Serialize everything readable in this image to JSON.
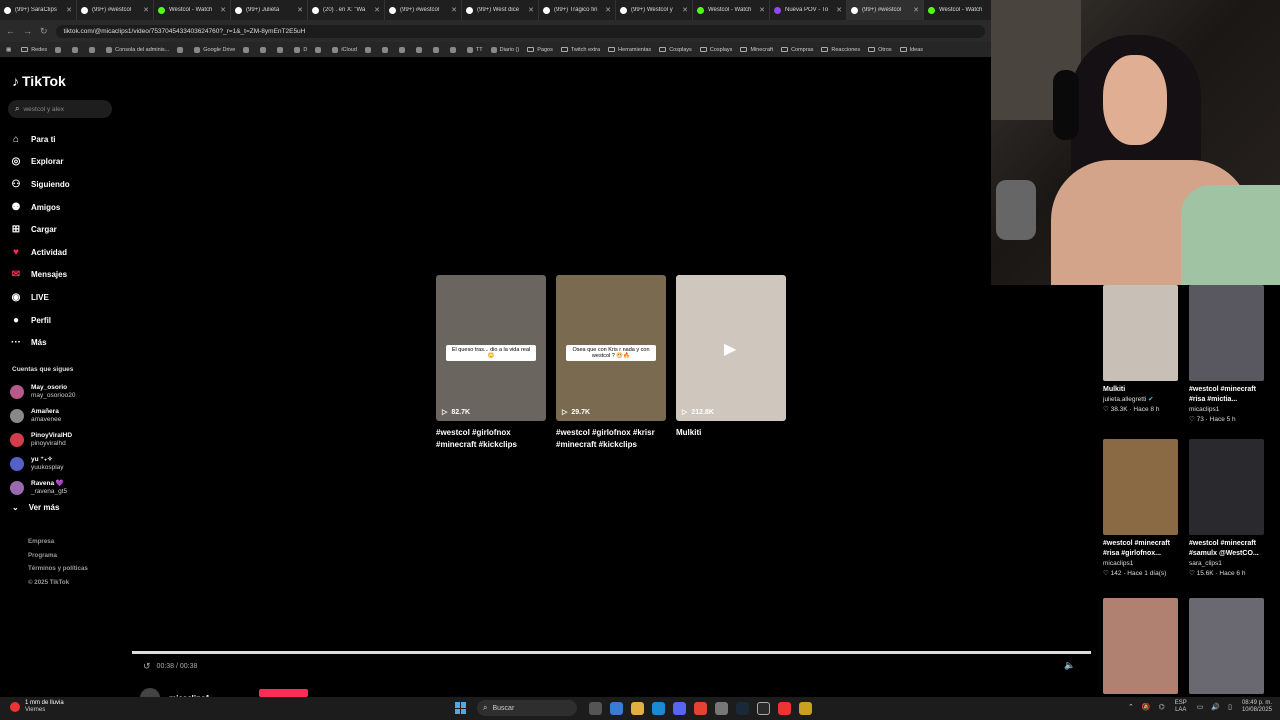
{
  "browser": {
    "tabs": [
      {
        "title": "(99+) SaraClips",
        "color": "#ffffff"
      },
      {
        "title": "(99+) #westcol",
        "color": "#ffffff"
      },
      {
        "title": "Westcol - Watch",
        "color": "#53fc18"
      },
      {
        "title": "(99+) Julieta",
        "color": "#ffffff"
      },
      {
        "title": "(20) . en X: \"Wa",
        "color": "#ffffff"
      },
      {
        "title": "(99+) #westcol",
        "color": "#ffffff"
      },
      {
        "title": "(99+) West dice",
        "color": "#ffffff"
      },
      {
        "title": "(99+) Trágico fin",
        "color": "#ffffff"
      },
      {
        "title": "(99+) Westcol y",
        "color": "#ffffff"
      },
      {
        "title": "Westcol - Watch",
        "color": "#53fc18"
      },
      {
        "title": "Nueva POV - To",
        "color": "#9146ff"
      },
      {
        "title": "(99+) #westcol",
        "color": "#ffffff"
      },
      {
        "title": "Westcol - Watch",
        "color": "#53fc18"
      }
    ],
    "url": "tiktok.com/@micaclips1/video/7537045433403624760?_r=1&_t=ZM-8ymEnT2E5uH",
    "bookmarks": [
      {
        "label": "Redes",
        "folder": true
      },
      {
        "label": "",
        "folder": false
      },
      {
        "label": "",
        "folder": false
      },
      {
        "label": "",
        "folder": false
      },
      {
        "label": "Consola del adminis...",
        "folder": false
      },
      {
        "label": "",
        "folder": false
      },
      {
        "label": "Google Drive",
        "folder": false
      },
      {
        "label": "",
        "folder": false
      },
      {
        "label": "",
        "folder": false
      },
      {
        "label": "",
        "folder": false
      },
      {
        "label": "D",
        "folder": false
      },
      {
        "label": "",
        "folder": false
      },
      {
        "label": "iCloud",
        "folder": false
      },
      {
        "label": "",
        "folder": false
      },
      {
        "label": "",
        "folder": false
      },
      {
        "label": "",
        "folder": false
      },
      {
        "label": "",
        "folder": false
      },
      {
        "label": "",
        "folder": false
      },
      {
        "label": "",
        "folder": false
      },
      {
        "label": "TT",
        "folder": false
      },
      {
        "label": "Diario ()",
        "folder": false
      },
      {
        "label": "Pagos",
        "folder": true
      },
      {
        "label": "Twitch extra",
        "folder": true
      },
      {
        "label": "Herramientas",
        "folder": true
      },
      {
        "label": "Cosplays",
        "folder": true
      },
      {
        "label": "Cosplays",
        "folder": true
      },
      {
        "label": "Minecraft",
        "folder": true
      },
      {
        "label": "Compras",
        "folder": true
      },
      {
        "label": "Reacciones",
        "folder": true
      },
      {
        "label": "Otros",
        "folder": true
      },
      {
        "label": "Ideas",
        "folder": true
      }
    ]
  },
  "tiktok": {
    "logo": "TikTok",
    "search_placeholder": "westcol y alex",
    "nav": [
      {
        "label": "Para ti",
        "icon": "home-icon",
        "glyph": "⌂"
      },
      {
        "label": "Explorar",
        "icon": "compass-icon",
        "glyph": "◎"
      },
      {
        "label": "Siguiendo",
        "icon": "following-icon",
        "glyph": "⚇"
      },
      {
        "label": "Amigos",
        "icon": "friends-icon",
        "glyph": "⚉"
      },
      {
        "label": "Cargar",
        "icon": "upload-icon",
        "glyph": "⊞"
      },
      {
        "label": "Actividad",
        "icon": "activity-icon",
        "glyph": "♥"
      },
      {
        "label": "Mensajes",
        "icon": "messages-icon",
        "glyph": "✉"
      },
      {
        "label": "LIVE",
        "icon": "live-icon",
        "glyph": "◉"
      },
      {
        "label": "Perfil",
        "icon": "profile-icon",
        "glyph": "●"
      },
      {
        "label": "Más",
        "icon": "more-icon",
        "glyph": "···"
      }
    ],
    "following_title": "Cuentas que sigues",
    "following": [
      {
        "name": "May_osorio",
        "handle": "may_osorioo20",
        "color": "#b65a8a"
      },
      {
        "name": "Amañera",
        "handle": "amavenee",
        "color": "#888888"
      },
      {
        "name": "PinoyViralHD",
        "handle": "pinoyviralhd",
        "color": "#d33c4a"
      },
      {
        "name": "yu ⁺₊✧",
        "handle": "yuukosplay",
        "color": "#5560c8"
      },
      {
        "name": "Ravena 💜",
        "handle": "_ravena_gt5",
        "color": "#9a6ab0"
      }
    ],
    "ver_mas": "Ver más",
    "footer": [
      "Empresa",
      "Programa",
      "Términos y políticas",
      "© 2025 TikTok"
    ]
  },
  "related_videos": [
    {
      "title": "#westcol #girlofnox #minecraft #kickclips",
      "views": "82.7K",
      "caption": "El queso tras... dio a la vida real 😳",
      "bg": "#6b6560"
    },
    {
      "title": "#westcol #girlofnox #krisr #minecraft #kickclips",
      "views": "29.7K",
      "caption": "Osea que con Kris r nada y con westcol ? 😬🔥",
      "bg": "#7a6a50"
    },
    {
      "title": "Mulkiti",
      "views": "212.8K",
      "caption": "",
      "bg": "#cfc6bd"
    }
  ],
  "recommended": [
    {
      "title": "Mulkiti",
      "author": "julieta.allegretti",
      "verified": true,
      "likes": "38.3K",
      "time": "Hace 8 h",
      "bg": "#c8bfb6"
    },
    {
      "title": "#westcol #minecraft #risa #mictia...",
      "author": "micaclips1",
      "verified": false,
      "likes": "73",
      "time": "Hace 5 h",
      "bg": "#595860"
    },
    {
      "title": "#westcol #minecraft #risa #girlofnox...",
      "author": "micaclips1",
      "verified": false,
      "likes": "142",
      "time": "Hace 1 día(s)",
      "bg": "#8a6a45"
    },
    {
      "title": "#westcol #minecraft #samulx @WestCO...",
      "author": "sara_clips1",
      "verified": false,
      "likes": "15.6K",
      "time": "Hace 6 h",
      "bg": "#2a2a2e"
    },
    {
      "title": "",
      "author": "",
      "verified": false,
      "likes": "",
      "time": "",
      "bg": "#b08070"
    },
    {
      "title": "",
      "author": "",
      "verified": false,
      "likes": "",
      "time": "",
      "bg": "#6a6870"
    }
  ],
  "player": {
    "time": "00:38 / 00:38",
    "progress": 1.0,
    "author": "micaclips1"
  },
  "taskbar": {
    "weather_temp": "1 mm de lluvia",
    "weather_day": "Viernes",
    "search": "Buscar",
    "lang_top": "ESP",
    "lang_bottom": "LAA",
    "time": "08:49 p. m.",
    "date": "10/08/2025"
  }
}
